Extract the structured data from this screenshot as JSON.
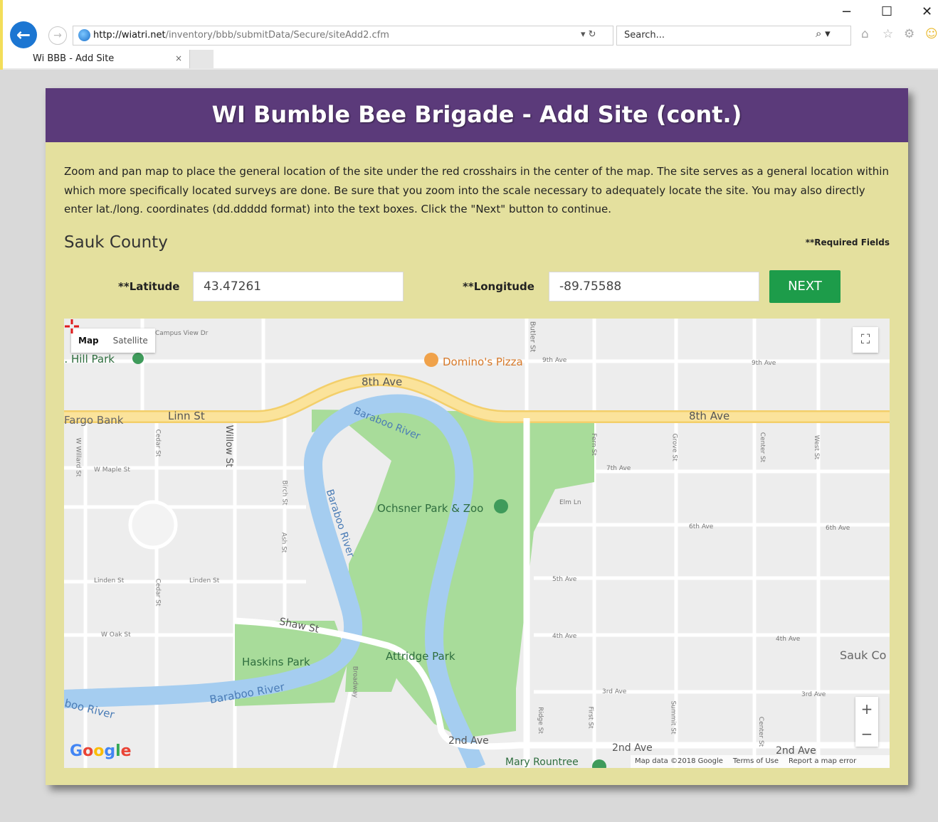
{
  "browser": {
    "url_host": "http://wiatri.net",
    "url_path": "/inventory/bbb/submitData/Secure/siteAdd2.cfm",
    "search_placeholder": "Search...",
    "tab_title": "Wi BBB - Add Site",
    "minimize": "−",
    "maximize": "☐",
    "close": "✕",
    "back": "←",
    "forward": "→",
    "tab_close": "×",
    "address_tools": "▾ ↻",
    "search_tools": "⌕ ▾"
  },
  "panel": {
    "title": "WI Bumble Bee Brigade - Add Site (cont.)",
    "instructions": "Zoom and pan map to place the general location of the site under the red crosshairs in the center of the map. The site serves as a general location within which more specifically located surveys are done. Be sure that you zoom into the scale necessary to adequately locate the site. You may also directly enter lat./long. coordinates (dd.ddddd format) into the text boxes. Click the \"Next\" button to continue.",
    "county": "Sauk County",
    "required_note": "**Required Fields",
    "latitude_label": "**Latitude",
    "latitude_value": "43.47261",
    "longitude_label": "**Longitude",
    "longitude_value": "-89.75588",
    "next_label": "NEXT"
  },
  "map": {
    "type_map": "Map",
    "type_satellite": "Satellite",
    "fullscreen": "⛶",
    "zoom_in": "+",
    "zoom_out": "−",
    "attribution": "Map data ©2018 Google",
    "terms": "Terms of Use",
    "report": "Report a map error",
    "labels": {
      "park_hill": "J. Hill Park",
      "campus_view": "Campus View Dr",
      "dominos": "Domino's Pizza",
      "ave8_a": "8th Ave",
      "ave8_b": "8th Ave",
      "linn": "Linn St",
      "fargo": "Fargo Bank",
      "baraboo1": "Baraboo River",
      "baraboo2": "Baraboo River",
      "baraboo3": "Baraboo River",
      "baraboo4": "boo River",
      "ochsner": "Ochsner Park & Zoo",
      "willow": "Willow St",
      "shaw": "Shaw St",
      "haskins": "Haskins Park",
      "attridge": "Attridge Park",
      "ave2_a": "2nd Ave",
      "ave2_b": "2nd Ave",
      "ave2_c": "2nd Ave",
      "sauk_co": "Sauk Co",
      "rountree": "Mary Rountree",
      "ave9": "9th Ave",
      "ave9b": "9th Ave",
      "ave7": "7th Ave",
      "ave6": "6th Ave",
      "ave6b": "6th Ave",
      "ave5": "5th Ave",
      "ave4": "4th Ave",
      "ave4b": "4th Ave",
      "ave3": "3rd Ave",
      "ave3b": "3rd Ave",
      "w_maple": "W Maple St",
      "w_oak": "W Oak St",
      "linden": "Linden St",
      "linden2": "Linden St",
      "cedar": "Cedar St",
      "cedar2": "Cedar St",
      "birch": "Birch St",
      "ash": "Ash St",
      "elm": "Elm Ln",
      "fern": "Fern St",
      "grove": "Grove St",
      "center": "Center St",
      "center2": "Center St",
      "west": "West St",
      "broadway": "Broadway",
      "ridge": "Ridge St",
      "butler": "Butler St",
      "summit": "Summit St",
      "first": "First St",
      "maple_w": "W Willard St"
    }
  },
  "colors": {
    "header": "#5b3a7a",
    "panel": "#e4e09e",
    "next": "#1d9c4a",
    "river": "#a5cdf0",
    "park": "#a8dc9a",
    "major_road": "#fbe39b",
    "crosshair": "#e01b1b"
  }
}
